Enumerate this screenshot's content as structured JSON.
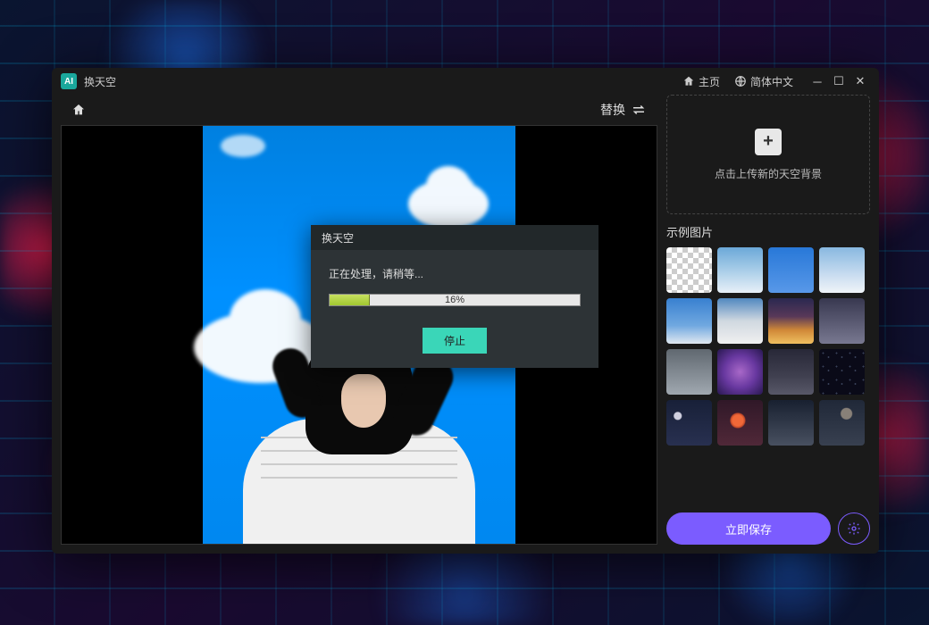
{
  "titlebar": {
    "app_badge": "AI",
    "title": "换天空",
    "home_label": "主页",
    "lang_label": "简体中文"
  },
  "canvas": {
    "replace_label": "替换"
  },
  "sidebar": {
    "upload_text": "点击上传新的天空背景",
    "samples_label": "示例图片",
    "save_label": "立即保存",
    "thumbs": [
      {
        "name": "transparent-checker"
      },
      {
        "name": "clouds-day-1"
      },
      {
        "name": "blue-sky-1"
      },
      {
        "name": "clouds-day-2"
      },
      {
        "name": "blue-clouds-2"
      },
      {
        "name": "clouds-day-3"
      },
      {
        "name": "sunset-1"
      },
      {
        "name": "storm-1"
      },
      {
        "name": "gray-clouds-1"
      },
      {
        "name": "purple-nebula"
      },
      {
        "name": "dark-clouds"
      },
      {
        "name": "stars-1"
      },
      {
        "name": "moon-night"
      },
      {
        "name": "eclipse"
      },
      {
        "name": "night-clouds-1"
      },
      {
        "name": "night-clouds-2"
      }
    ],
    "thumb_styles": [
      "background:repeating-conic-gradient(#ccc 0 25%,#fff 0 50%) 0 0/12px 12px",
      "background:linear-gradient(180deg,#6ba8d8 0%,#a8cde8 50%,#e8f0f8 100%)",
      "background:linear-gradient(180deg,#2878d8 0%,#5898e8 100%)",
      "background:linear-gradient(180deg,#88b8e0 0%,#c8dcf0 60%,#f0f4f8 100%)",
      "background:linear-gradient(180deg,#3880d0 0%,#70a8e0 60%,#e0e8f0 100%)",
      "background:linear-gradient(180deg,#5088c0 0%,#d0d8e0 50%,#f0f0f0 100%)",
      "background:linear-gradient(180deg,#2a2850 0%,#583858 40%,#d08838 70%,#f0c060 100%)",
      "background:linear-gradient(180deg,#383850 0%,#585870 50%,#787890 100%)",
      "background:linear-gradient(180deg,#606870 0%,#808890 50%,#a0a8b0 100%)",
      "background:radial-gradient(circle at 50% 50%,#a868c8 0%,#6838a0 50%,#281850 100%)",
      "background:linear-gradient(180deg,#282838 0%,#404050 60%,#585868 100%)",
      "background:radial-gradient(circle at 30% 30%,#384058 1px,transparent 1px),radial-gradient(circle at 70% 60%,#384058 1px,transparent 1px),#0a0a18;background-size:15px 15px",
      "background:radial-gradient(circle at 25% 35%,#d0d0e0 4px,transparent 5px),linear-gradient(180deg,#182038 0%,#283050 100%)",
      "background:radial-gradient(circle at 45% 45%,#f06838 6px,#c04828 8px,transparent 9px),linear-gradient(180deg,#301828 0%,#502838 100%)",
      "background:linear-gradient(180deg,#182030 0%,#303848 50%,#485060 100%)",
      "background:radial-gradient(circle at 60% 30%,#888078 6px,transparent 7px),linear-gradient(180deg,#202838 0%,#384050 100%)"
    ]
  },
  "dialog": {
    "title": "换天空",
    "message": "正在处理，请稍等...",
    "progress_percent": 16,
    "progress_text": "16%",
    "stop_label": "停止"
  }
}
